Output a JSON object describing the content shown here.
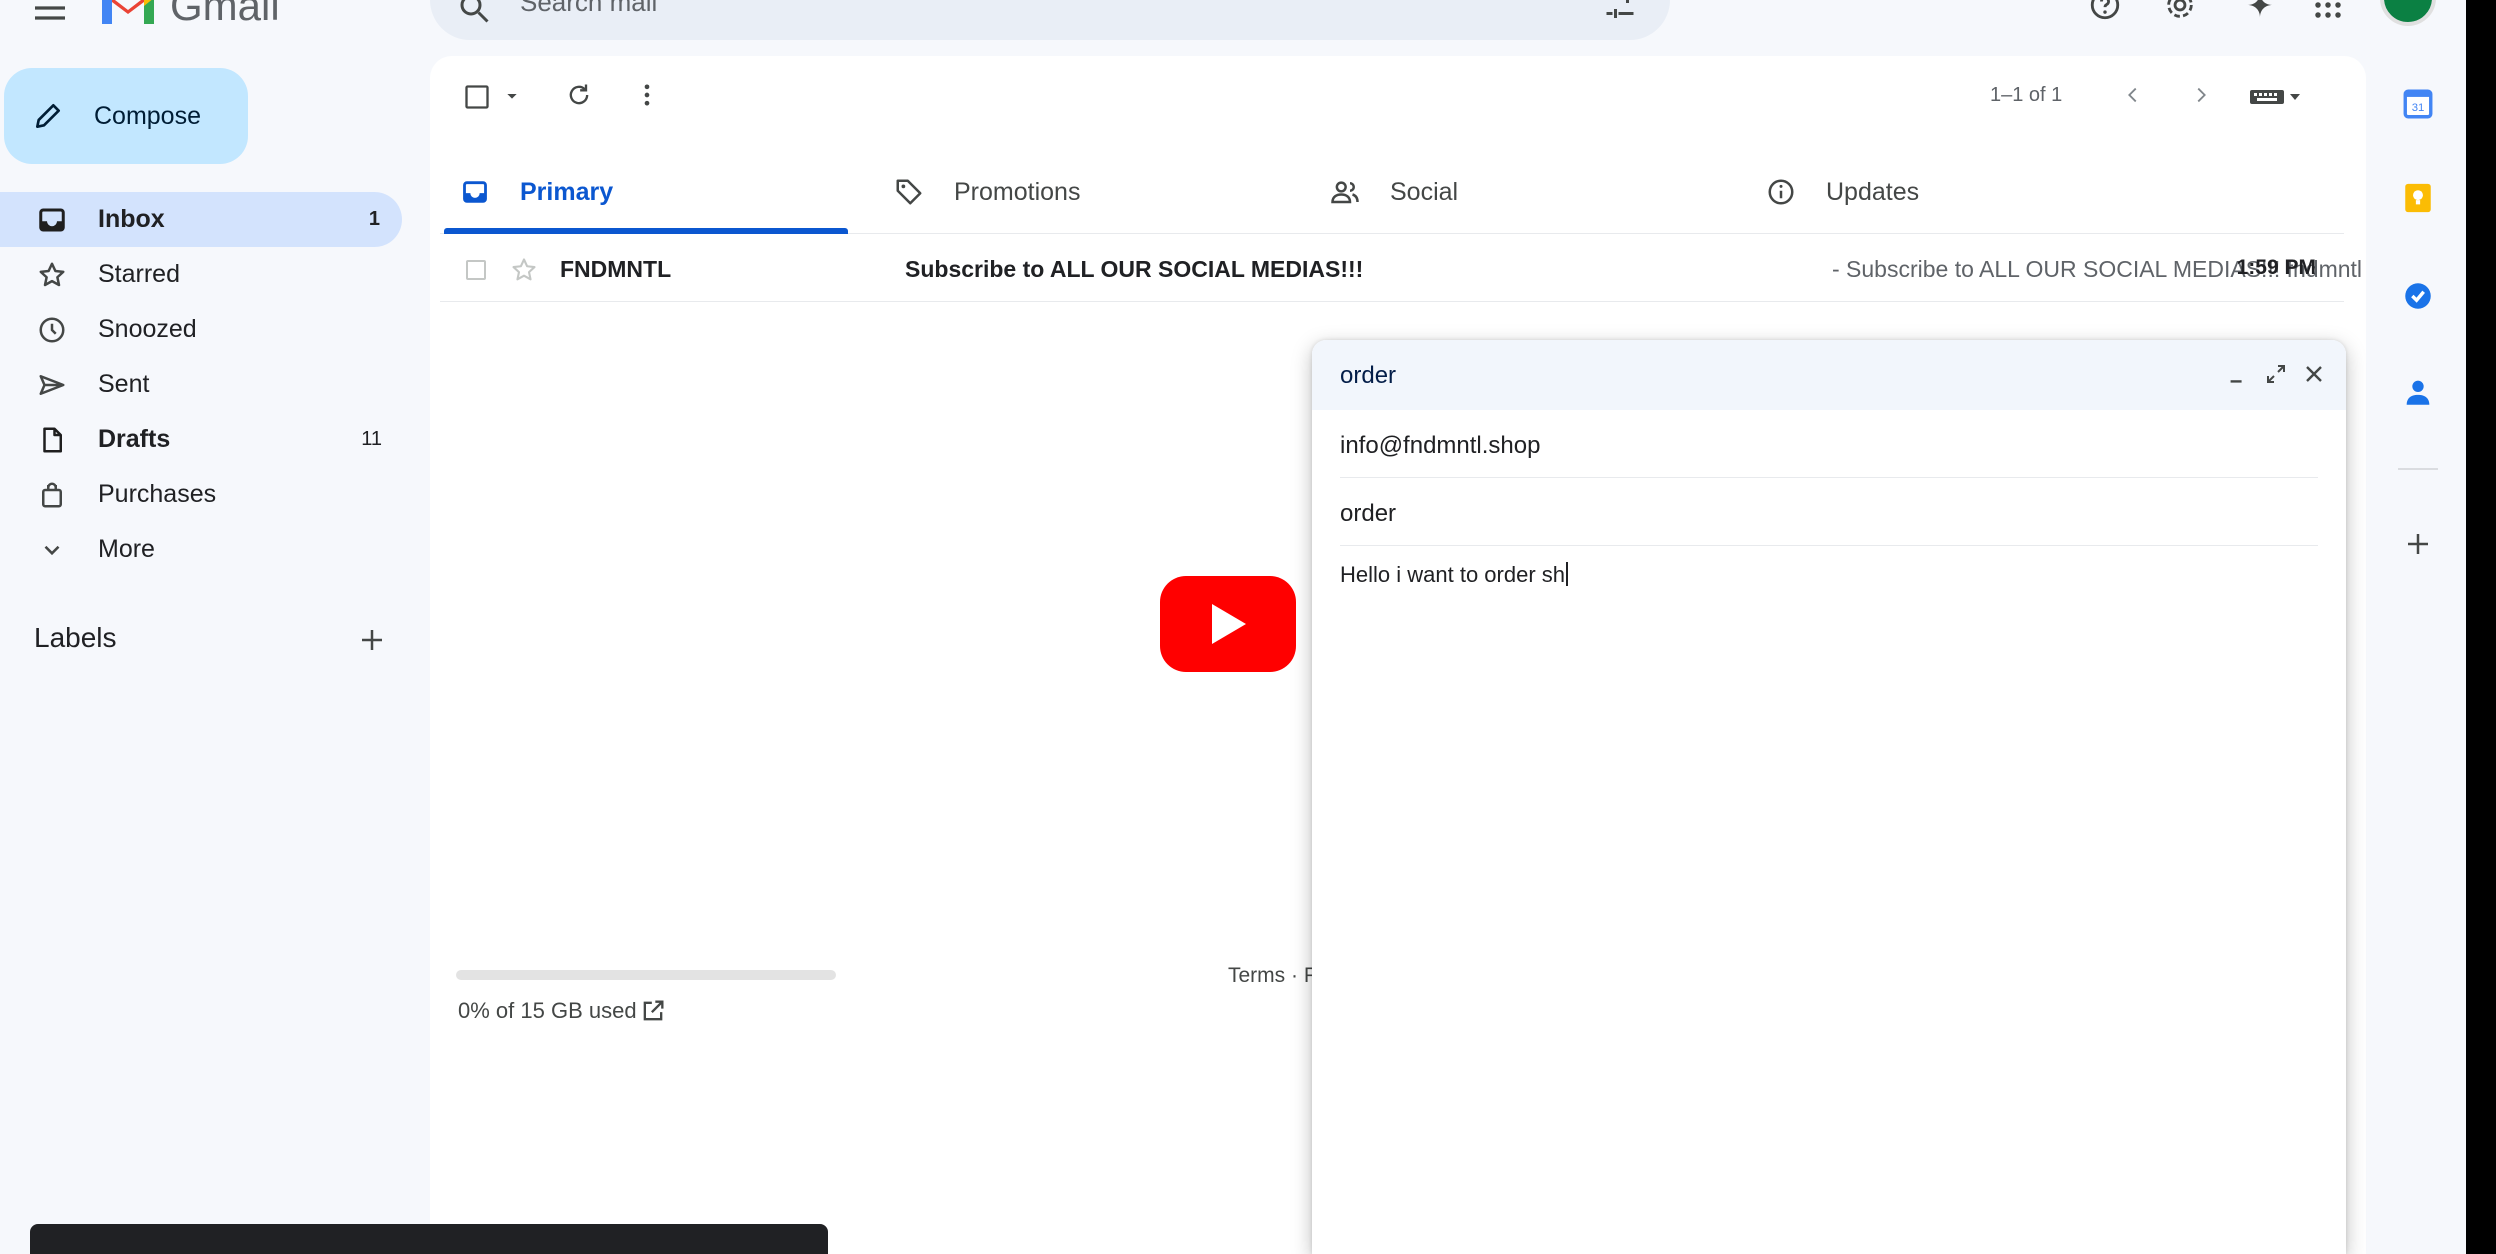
{
  "app": {
    "name": "Gmail"
  },
  "search": {
    "placeholder": "Search mail"
  },
  "sidebar": {
    "compose_label": "Compose",
    "items": [
      {
        "label": "Inbox",
        "count": "1",
        "icon": "inbox-icon"
      },
      {
        "label": "Starred",
        "count": "",
        "icon": "star-icon"
      },
      {
        "label": "Snoozed",
        "count": "",
        "icon": "clock-icon"
      },
      {
        "label": "Sent",
        "count": "",
        "icon": "send-icon"
      },
      {
        "label": "Drafts",
        "count": "11",
        "icon": "draft-icon"
      },
      {
        "label": "Purchases",
        "count": "",
        "icon": "shopping-bag-icon"
      },
      {
        "label": "More",
        "count": "",
        "icon": "chevron-down-icon"
      }
    ],
    "labels_heading": "Labels"
  },
  "toolbar": {
    "pagination": "1–1 of 1"
  },
  "tabs": [
    {
      "label": "Primary",
      "icon": "inbox-icon"
    },
    {
      "label": "Promotions",
      "icon": "tag-icon"
    },
    {
      "label": "Social",
      "icon": "people-icon"
    },
    {
      "label": "Updates",
      "icon": "info-icon"
    }
  ],
  "emails": [
    {
      "sender": "FNDMNTL",
      "subject": "Subscribe to ALL OUR SOCIAL MEDIAS!!!",
      "snippet": " - Subscribe to ALL OUR SOCIAL MEDIAS!!! fndmntl",
      "time": "1:59 PM"
    }
  ],
  "storage": {
    "text": "0% of 15 GB used",
    "used_fraction": 0.0
  },
  "footer": {
    "terms": "Terms · P"
  },
  "compose_window": {
    "title": "order",
    "to": "info@fndmntl.shop",
    "subject": "order",
    "body": "Hello i want to order sh"
  },
  "colors": {
    "accent": "#0b57d0",
    "compose_bg": "#c2e7ff",
    "active_nav": "#d3e3fd",
    "play_button": "#ff0000"
  }
}
